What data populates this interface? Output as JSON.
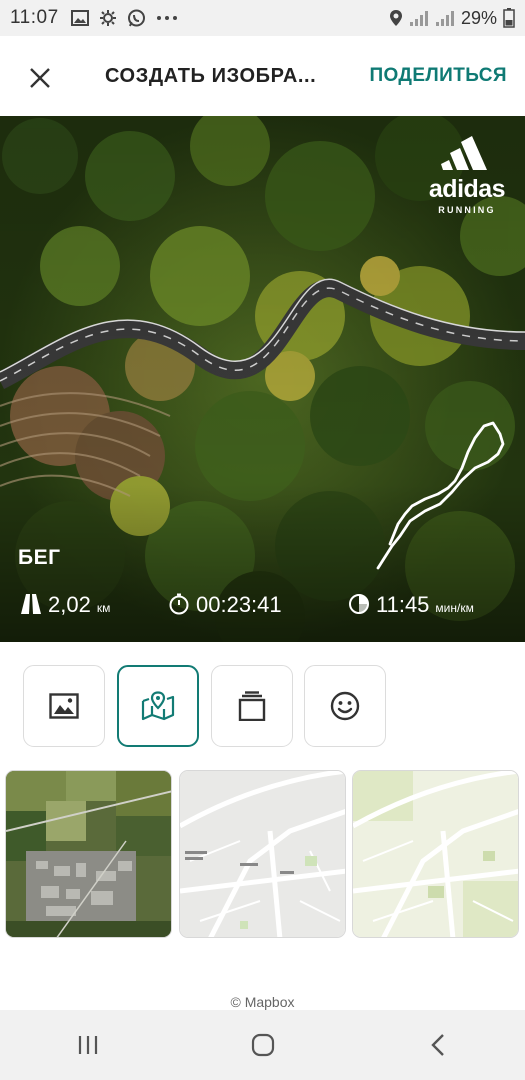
{
  "status_bar": {
    "time": "11:07",
    "left_icons": [
      "image-icon",
      "gear-icon",
      "whatsapp-icon",
      "more-dots-icon"
    ],
    "right_icons": [
      "location-icon",
      "signal-icon",
      "signal-icon"
    ],
    "battery": "29%"
  },
  "header": {
    "title": "СОЗДАТЬ ИЗОБРА...",
    "share_label": "ПОДЕЛИТЬСЯ",
    "close_icon": "close-icon"
  },
  "hero": {
    "brand_name": "adidas",
    "brand_sub": "RUNNING",
    "activity_type": "БЕГ",
    "stats": {
      "distance_value": "2,02",
      "distance_unit": "км",
      "duration_value": "00:23:41",
      "pace_value": "11:45",
      "pace_unit": "мин/км"
    }
  },
  "tools": [
    {
      "name": "photo",
      "icon": "image-icon",
      "active": false
    },
    {
      "name": "map",
      "icon": "map-pin-icon",
      "active": true
    },
    {
      "name": "layers",
      "icon": "layers-icon",
      "active": false
    },
    {
      "name": "sticker",
      "icon": "smiley-icon",
      "active": false
    }
  ],
  "map_styles": [
    "satellite",
    "streets",
    "outdoors"
  ],
  "attribution": "© Mapbox",
  "colors": {
    "accent": "#127b74",
    "share_text": "#0f7a74",
    "bar_bg": "#f1f1f1"
  }
}
